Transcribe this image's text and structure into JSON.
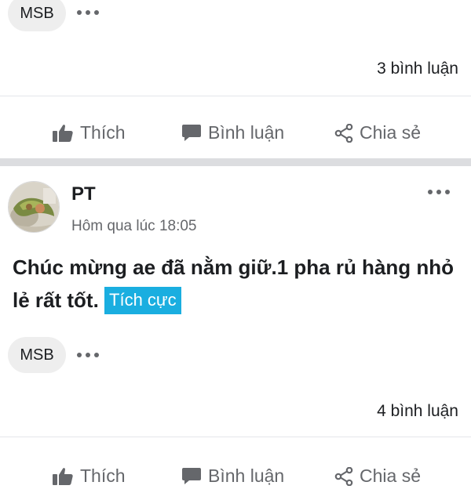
{
  "post1": {
    "tag": "MSB",
    "comment_count": "3 bình luận"
  },
  "actions": {
    "like": "Thích",
    "comment": "Bình luận",
    "share": "Chia sẻ"
  },
  "post2": {
    "author": "PT",
    "timestamp": "Hôm qua lúc 18:05",
    "text": "Chúc mừng ae đã nằm giữ.1 pha rủ hàng nhỏ lẻ rất tốt.",
    "sentiment": "Tích cực",
    "tag": "MSB",
    "comment_count": "4 bình luận"
  },
  "colors": {
    "sentiment_badge": "#1aaee0",
    "action_text": "#65676b",
    "section_gap": "#dcdde0"
  }
}
